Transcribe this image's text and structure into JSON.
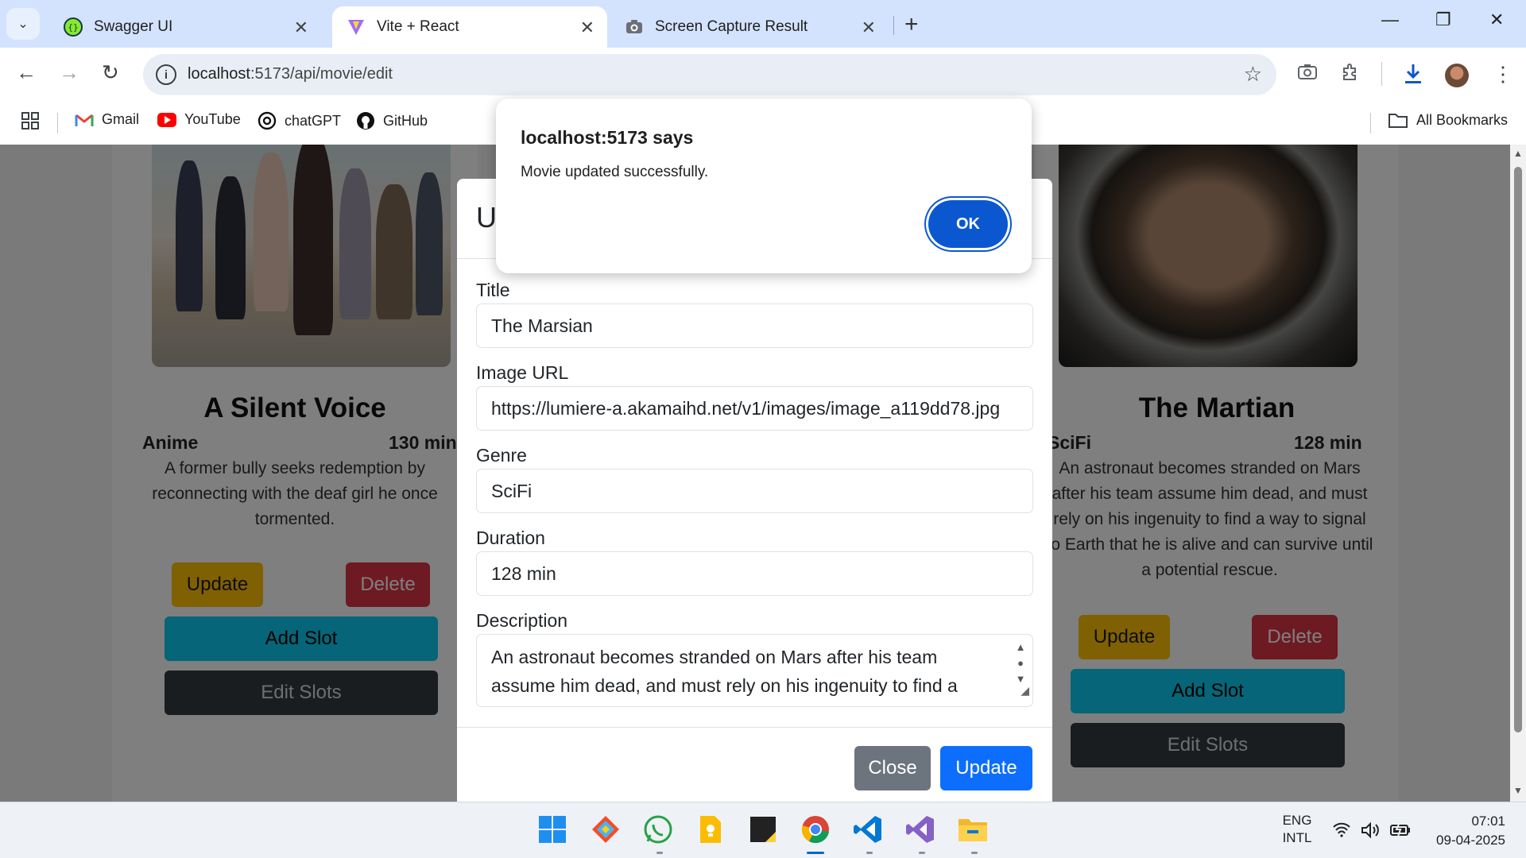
{
  "browser": {
    "tabs": [
      {
        "title": "Swagger UI",
        "icon": "swagger-icon",
        "active": false
      },
      {
        "title": "Vite + React",
        "icon": "vite-icon",
        "active": true
      },
      {
        "title": "Screen Capture Result",
        "icon": "camera-icon",
        "active": false
      }
    ],
    "url_host": "localhost",
    "url_path": ":5173/api/movie/edit",
    "bookmarks": [
      {
        "label": "Gmail",
        "icon": "gmail-icon"
      },
      {
        "label": "YouTube",
        "icon": "youtube-icon"
      },
      {
        "label": "chatGPT",
        "icon": "chatgpt-icon"
      },
      {
        "label": "GitHub",
        "icon": "github-icon"
      }
    ],
    "all_bookmarks_label": "All Bookmarks"
  },
  "movies": [
    {
      "title": "A Silent Voice",
      "genre": "Anime",
      "duration": "130 min",
      "description_lines": [
        "A former bully seeks redemption by",
        "reconnecting with the deaf girl he once",
        "tormented."
      ],
      "update_label": "Update",
      "delete_label": "Delete",
      "add_slot_label": "Add Slot",
      "edit_slots_label": "Edit Slots"
    },
    {
      "title": "The Martian",
      "genre": "SciFi",
      "duration": "128 min",
      "description_lines": [
        "An astronaut becomes stranded on Mars",
        "after his team assume him dead, and must",
        "rely on his ingenuity to find a way to signal",
        "to Earth that he is alive and can survive until",
        "a potential rescue."
      ],
      "update_label": "Update",
      "delete_label": "Delete",
      "add_slot_label": "Add Slot",
      "edit_slots_label": "Edit Slots"
    }
  ],
  "modal": {
    "title_visible": "U",
    "close_glyph": "×",
    "fields": {
      "title_label": "Title",
      "title_value": "The Marsian",
      "image_label": "Image URL",
      "image_value": "https://lumiere-a.akamaihd.net/v1/images/image_a119dd78.jpg",
      "genre_label": "Genre",
      "genre_value": "SciFi",
      "duration_label": "Duration",
      "duration_value": "128 min",
      "description_label": "Description",
      "description_value": "An astronaut becomes stranded on Mars after his team assume him dead, and must rely on his ingenuity to find a"
    },
    "close_button": "Close",
    "update_button": "Update"
  },
  "alert": {
    "title": "localhost:5173 says",
    "message": "Movie updated successfully.",
    "ok_label": "OK"
  },
  "taskbar": {
    "lang_line1": "ENG",
    "lang_line2": "INTL",
    "time": "07:01",
    "date": "09-04-2025"
  },
  "colors": {
    "primary": "#0d6efd",
    "warning": "#ffc107",
    "danger": "#dc3545",
    "info": "#0dcaf0",
    "dark": "#343a40",
    "secondary": "#6c757d",
    "chrome_accent": "#0b57d0"
  }
}
